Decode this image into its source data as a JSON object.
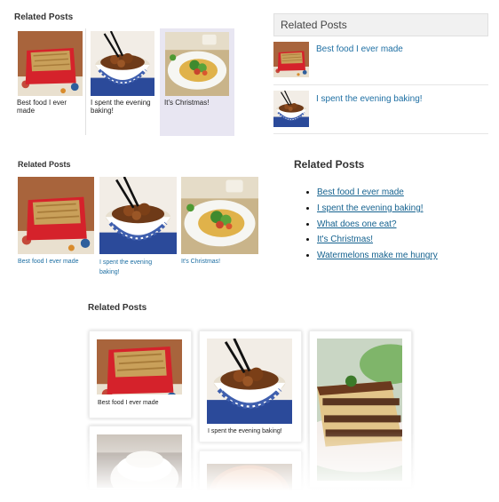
{
  "panel_a": {
    "heading": "Related Posts",
    "items": [
      {
        "caption": "Best food I ever made",
        "image": "casserole-photo"
      },
      {
        "caption": "I spent the evening baking!",
        "image": "noodle-bowl-photo"
      },
      {
        "caption": "It's Christmas!",
        "image": "salad-plate-photo"
      }
    ]
  },
  "panel_b": {
    "heading": "Related Posts",
    "items": [
      {
        "title": "Best food I ever made",
        "image": "casserole-photo"
      },
      {
        "title": "I spent the evening baking!",
        "image": "noodle-bowl-photo"
      }
    ]
  },
  "panel_c": {
    "heading": "Related Posts",
    "items": [
      {
        "caption": "Best food I ever made",
        "image": "casserole-photo"
      },
      {
        "caption": "I spent the evening baking!",
        "image": "noodle-bowl-photo"
      },
      {
        "caption": "It's Christmas!",
        "image": "salad-plate-photo"
      }
    ]
  },
  "panel_d": {
    "heading": "Related Posts",
    "links": [
      "Best food I ever made",
      "I spent the evening baking!",
      "What does one eat?",
      "It's Christmas!",
      "Watermelons make me hungry"
    ]
  },
  "panel_e": {
    "heading": "Related Posts",
    "items": [
      {
        "caption": "Best food I ever made",
        "image": "casserole-photo"
      },
      {
        "caption": "I spent the evening baking!",
        "image": "noodle-bowl-photo"
      },
      {
        "caption": "",
        "image": "layer-cake-photo"
      },
      {
        "caption": "",
        "image": "meringue-photo"
      },
      {
        "caption": "",
        "image": "pie-photo"
      }
    ]
  },
  "colors": {
    "link": "#1e6fa3",
    "heading": "#333333",
    "highlight": "#e8e6f2",
    "widget_header": "#f1f1f1"
  }
}
